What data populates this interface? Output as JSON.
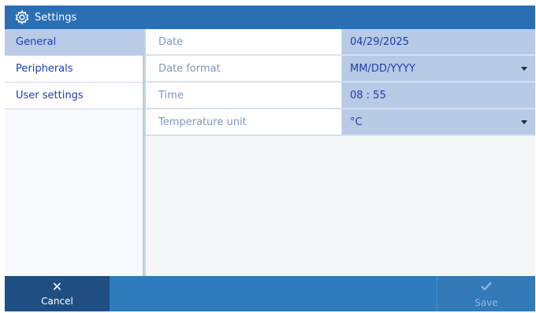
{
  "window": {
    "title": "Settings",
    "icon": "gear-icon"
  },
  "sidebar": {
    "items": [
      {
        "label": "General",
        "active": true
      },
      {
        "label": "Peripherals",
        "active": false
      },
      {
        "label": "User settings",
        "active": false
      }
    ]
  },
  "settings": {
    "rows": [
      {
        "label": "Date",
        "value": "04/29/2025",
        "dropdown": false
      },
      {
        "label": "Date format",
        "value": "MM/DD/YYYY",
        "dropdown": true
      },
      {
        "label": "Time",
        "value": "08 : 55",
        "dropdown": false
      },
      {
        "label": "Temperature unit",
        "value": "°C",
        "dropdown": true
      }
    ]
  },
  "footer": {
    "cancel_label": "Cancel",
    "cancel_icon": "close-icon",
    "save_label": "Save",
    "save_icon": "checkmark-icon",
    "save_enabled": false
  },
  "colors": {
    "titlebar": "#2a6fb4",
    "footer": "#2e7bbd",
    "cancel_bg": "#1f4f82",
    "active_item": "#b9cbe6",
    "value_bg": "#b7cae6",
    "link_text": "#1a3dbd"
  }
}
